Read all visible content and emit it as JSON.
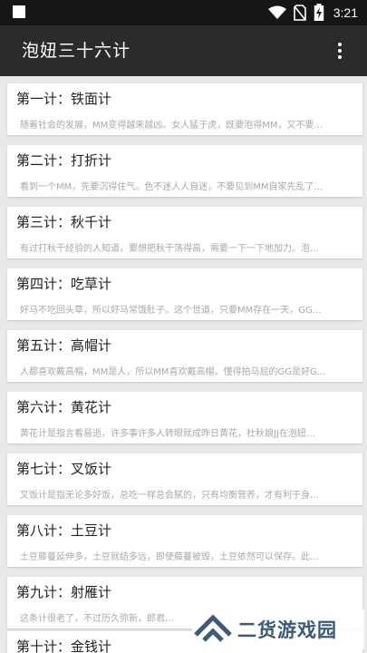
{
  "status_bar": {
    "time": "3:21"
  },
  "app_bar": {
    "title": "泡妞三十六计"
  },
  "items": [
    {
      "title": "第一计：铁面计",
      "desc": "随着社会的发展，MM变得越来越凶。女人猛于虎，既要泡得MM，又不要…"
    },
    {
      "title": "第二计：打折计",
      "desc": "看到一个MM，先要沉得住气。色不迷人人自迷，不要见到MM自家先乱了…"
    },
    {
      "title": "第三计：秋千计",
      "desc": "有过打秋千经验的人知道，要想把秋千荡得高，需要一下一下地加力。泡…"
    },
    {
      "title": "第四计：吃草计",
      "desc": "好马不吃回头草，所以好马常饿肚子。这个世道，只要MM存在一天，GG…"
    },
    {
      "title": "第五计：高帽计",
      "desc": "人都喜欢戴高帽，MM是人，所以MM喜欢戴高帽。懂得拍马屁的GG是好G…"
    },
    {
      "title": "第六计：黄花计",
      "desc": "黄花计是指言看易逝，许多事许多人转眼就成昨日黄花，杜秋娘JJ在泡妞…"
    },
    {
      "title": "第七计：叉饭计",
      "desc": "叉饭计是指无论多好饭，总吃一样总会腻的，只有均衡营养，才有利于身…"
    },
    {
      "title": "第八计：土豆计",
      "desc": "土豆藤蔓延伸多，土豆就结多远，即使藤蔓被毁，土豆依然可以保存。此…"
    },
    {
      "title": "第九计：射雁计",
      "desc": "这条计很老了，不过历久弥新，郎君…"
    },
    {
      "title": "第十计：金钱计",
      "desc": ""
    }
  ],
  "watermark": {
    "text": "二货游戏园"
  },
  "colors": {
    "status_bar": "#161616",
    "app_bar": "#2b2b2b",
    "background": "#e9e9e9",
    "watermark": "#3c5a7a"
  },
  "icons": [
    "wifi-icon",
    "no-sim-icon",
    "battery-charging-icon",
    "overflow-menu-icon"
  ]
}
